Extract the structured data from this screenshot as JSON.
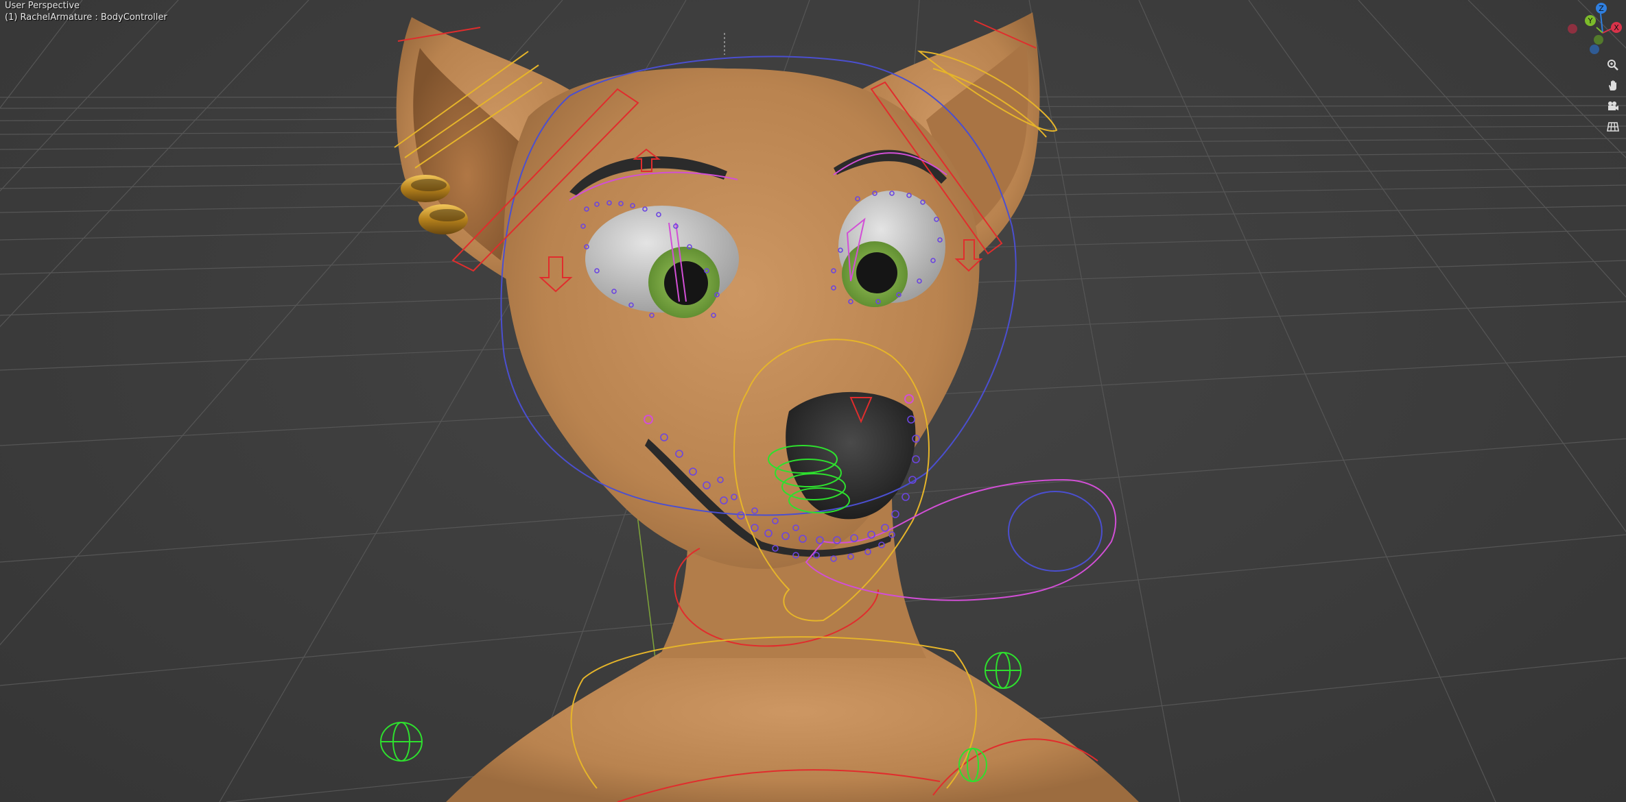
{
  "viewport": {
    "view_name": "User Perspective",
    "active_object": "(1) RachelArmature : BodyController"
  },
  "gizmo": {
    "axes": [
      {
        "label": "Z",
        "color": "#2f7fe0"
      },
      {
        "label": "Y",
        "color": "#7cbc2a"
      },
      {
        "label": "X",
        "color": "#d9334a"
      }
    ]
  },
  "navigation_tools": [
    {
      "name": "zoom-icon"
    },
    {
      "name": "pan-hand-icon"
    },
    {
      "name": "camera-icon"
    },
    {
      "name": "grid-ortho-icon"
    }
  ],
  "colors": {
    "background": "#3d3d3d",
    "grid_line": "#555555",
    "skin": "#c08a57",
    "bone_red": "#e02d2d",
    "bone_yellow": "#e6b52a",
    "bone_blue": "#4b4fd0",
    "bone_magenta": "#d24fd6",
    "bone_green": "#2ee02e"
  }
}
